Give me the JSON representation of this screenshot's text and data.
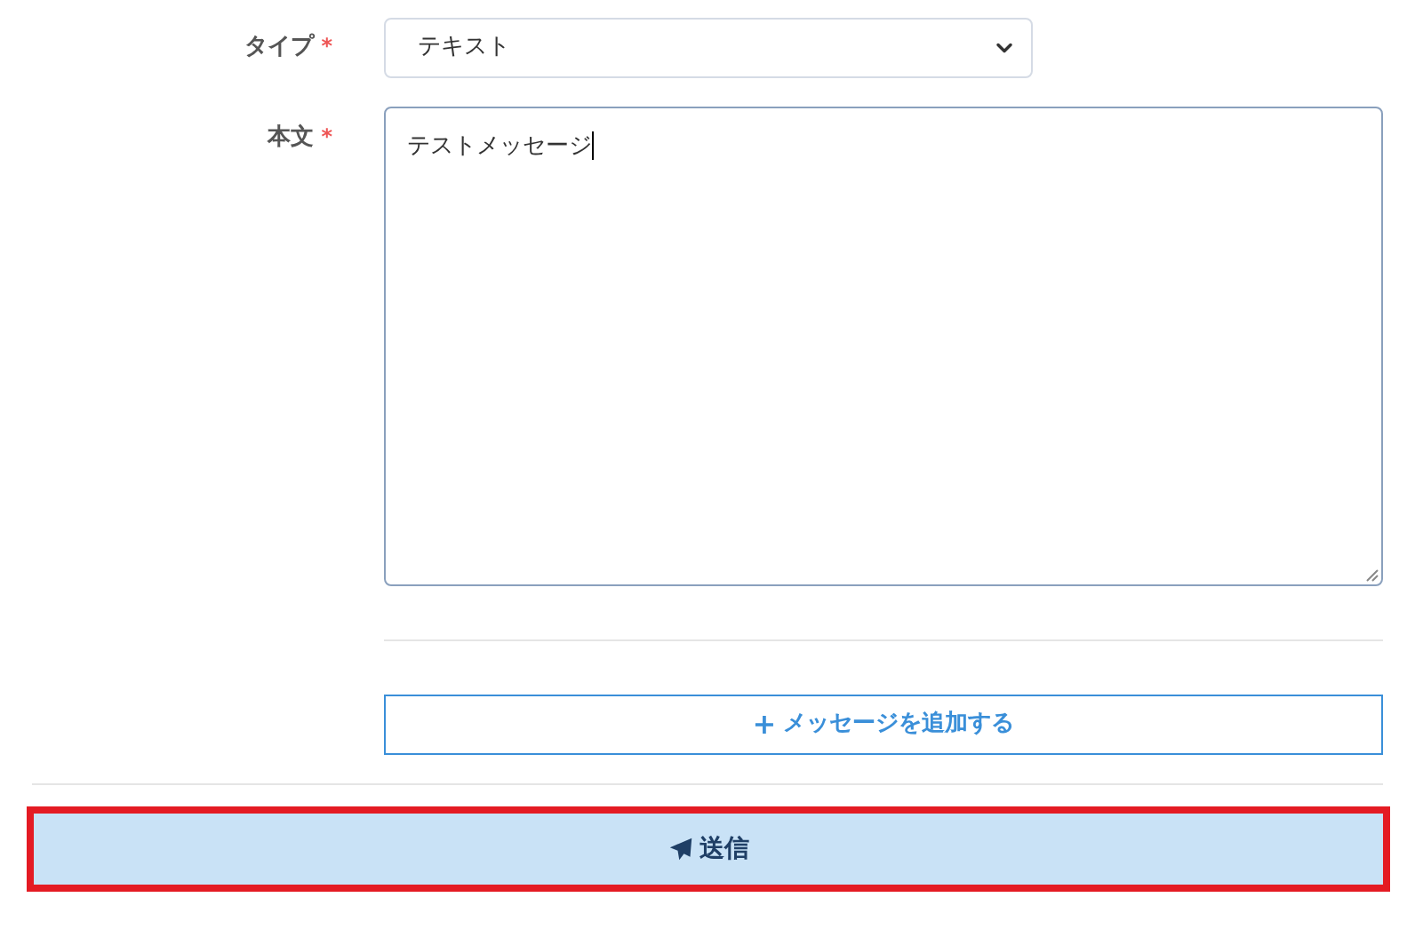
{
  "fields": [
    {
      "kind": "select",
      "label": "タイプ",
      "required_mark": "*",
      "value": "テキスト"
    },
    {
      "kind": "textarea",
      "label": "本文",
      "required_mark": "*",
      "value": "テストメッセージ"
    }
  ],
  "add_button": {
    "icon": "+",
    "label": "メッセージを追加する"
  },
  "submit_button": {
    "label": "送信",
    "highlighted": true
  }
}
